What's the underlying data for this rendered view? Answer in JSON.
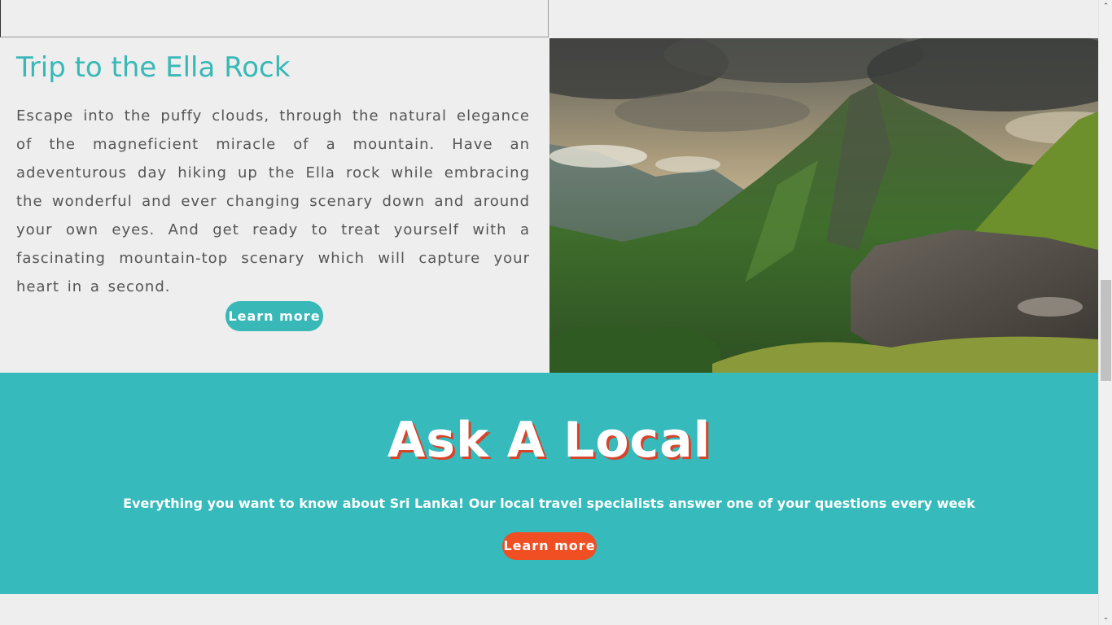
{
  "trip": {
    "title": "Trip to the Ella Rock",
    "description": "Escape into the puffy clouds, through the natural elegance of the magneficient miracle of a mountain. Have an adeventurous day hiking up the Ella rock while embracing the wonderful and ever changing scenary down and around your own eyes. And get ready to treat yourself with a fascinating mountain-top scenary which will capture your heart in a second.",
    "button_label": "Learn more",
    "image_icon": "mountain-photo"
  },
  "ask": {
    "title": "Ask A Local",
    "subtitle": "Everything you want to know about Sri Lanka! Our local travel specialists answer one of your questions every week",
    "button_label": "Learn more"
  },
  "scrollbar": {
    "up_icon": "chevron-up-icon",
    "down_icon": "chevron-down-icon",
    "up_glyph": "⌃",
    "down_glyph": "⌄"
  },
  "colors": {
    "accent_teal": "#38b8b6",
    "section_teal": "#36babb",
    "button_orange": "#f04e23",
    "title_shadow": "#d8432b",
    "body_text": "#555555",
    "page_bg": "#eeeeee"
  }
}
